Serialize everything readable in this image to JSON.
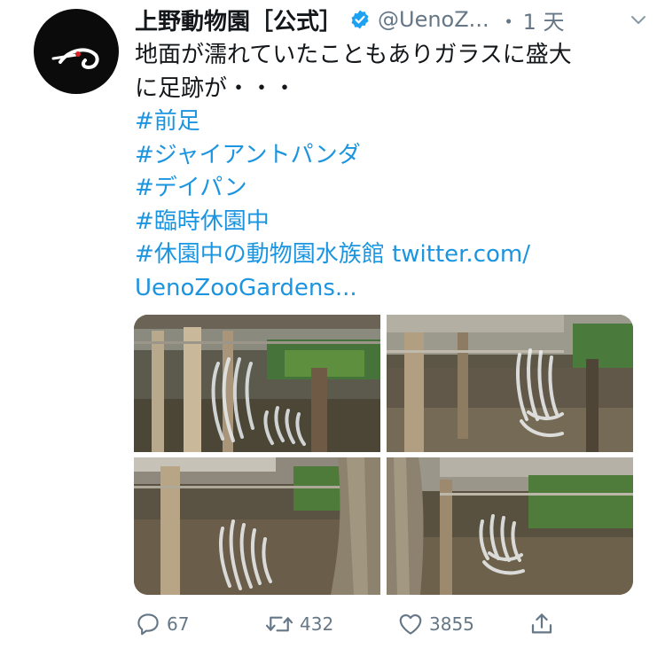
{
  "tweet": {
    "account_name": "上野動物園［公式］",
    "handle": "@UenoZ...",
    "separator": "・",
    "time": "1 天",
    "text_lines": [
      "地面が濡れていたこともありガラスに盛大",
      "に足跡が・・・"
    ],
    "hashtags": [
      "#前足",
      "#ジャイアントパンダ",
      "#デイパン",
      "#臨時休園中"
    ],
    "last_line_hashtag": "#休園中の動物園水族館",
    "link_part1": "twitter.com/",
    "link_part2": "UenoZooGardens..."
  },
  "actions": {
    "reply_count": "67",
    "retweet_count": "432",
    "like_count": "3855"
  },
  "colors": {
    "link": "#1b95e0",
    "secondary_text": "#657786",
    "verified": "#1da1f2"
  }
}
